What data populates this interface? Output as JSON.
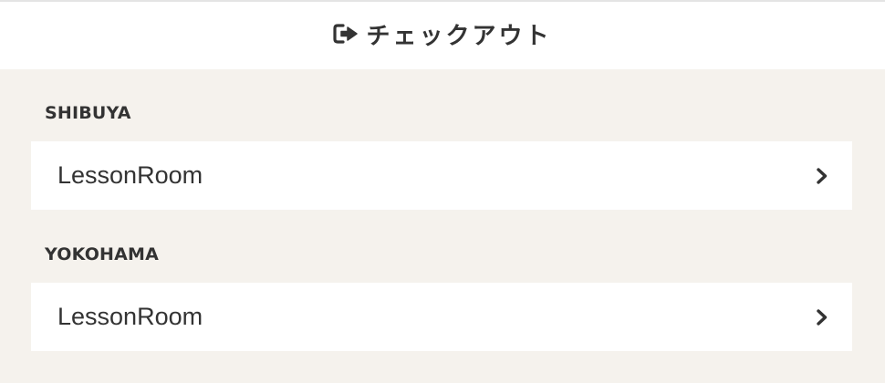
{
  "header": {
    "title": "チェックアウト",
    "icon": "sign-out-icon"
  },
  "locations": [
    {
      "name": "SHIBUYA",
      "rooms": [
        {
          "label": "LessonRoom",
          "icon": "chevron-right-icon"
        }
      ]
    },
    {
      "name": "YOKOHAMA",
      "rooms": [
        {
          "label": "LessonRoom",
          "icon": "chevron-right-icon"
        }
      ]
    }
  ],
  "colors": {
    "background": "#f5f2ed",
    "surface": "#ffffff",
    "text": "#333333"
  }
}
